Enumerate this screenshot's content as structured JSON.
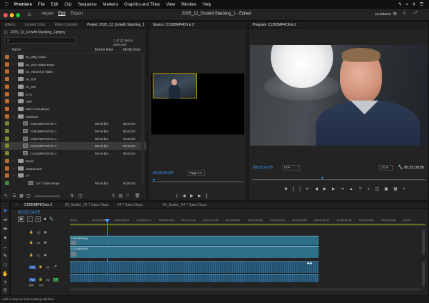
{
  "menubar": {
    "app_name": "Premiere",
    "items": [
      "File",
      "Edit",
      "Clip",
      "Sequence",
      "Markers",
      "Graphics and Titles",
      "View",
      "Window",
      "Help"
    ],
    "clock_area_icons": [
      "apple-logo-icon",
      "pencil-icon",
      "wifi-icon",
      "search-icon",
      "control-center-icon"
    ]
  },
  "appbar": {
    "tabs": [
      "Import",
      "Edit",
      "Export"
    ],
    "title": "2025_12_Growth Stacking_1 - Edited",
    "learning": "LEARNING"
  },
  "project_panel": {
    "tabs": [
      "Effects",
      "Lumetri Color",
      "Effect Controls",
      "Project: 2025_12_Growth Stacking_1"
    ],
    "project_file": "2025_12_Growth Stacking_1.prproj",
    "search_placeholder": "",
    "selection_info": "1 of 21 items selected",
    "columns": {
      "name": "Name",
      "frame_rate": "Frame Rate",
      "media_start": "Media Start"
    },
    "items": [
      {
        "name": "01_Why Video",
        "type": "bin",
        "color": "#c46a2a"
      },
      {
        "name": "02_24/7 Sales Reps",
        "type": "bin",
        "color": "#c46a2a"
      },
      {
        "name": "02_About Us Video",
        "type": "bin",
        "color": "#c46a2a"
      },
      {
        "name": "04_ICP",
        "type": "bin",
        "color": "#c46a2a"
      },
      {
        "name": "04_ICP",
        "type": "bin",
        "color": "#c46a2a"
      },
      {
        "name": "KYC",
        "type": "bin",
        "color": "#c46a2a"
      },
      {
        "name": "ABV",
        "type": "bin",
        "color": "#c46a2a"
      },
      {
        "name": "Main Animations",
        "type": "bin",
        "color": "#c46a2a"
      },
      {
        "name": "Multicam",
        "type": "bin-open",
        "color": "#c46a2a"
      },
      {
        "name": "C0614MP4Chris 1",
        "type": "clip",
        "color": "#7c8a2e",
        "fps": "59.94 fps",
        "start": "00;00;00"
      },
      {
        "name": "C0615MP4Chris 2",
        "type": "clip",
        "color": "#7c8a2e",
        "fps": "59.94 fps",
        "start": "00;00;00"
      },
      {
        "name": "C0637MP4Chris 2",
        "type": "clip",
        "color": "#7c8a2e",
        "fps": "59.94 fps",
        "start": "00;00;00"
      },
      {
        "name": "C1202MP4Chris 2",
        "type": "clip",
        "color": "#7c8a2e",
        "fps": "59.94 fps",
        "start": "00;00;00",
        "selected": true
      },
      {
        "name": "C1203MP4Chris 2",
        "type": "clip",
        "color": "#7c8a2e",
        "fps": "59.94 fps",
        "start": "00;00;00"
      },
      {
        "name": "Music",
        "type": "bin",
        "color": "#c46a2a"
      },
      {
        "name": "Sequences",
        "type": "bin-open",
        "color": "#c46a2a"
      },
      {
        "name": "YT",
        "type": "bin-open",
        "color": "#c46a2a"
      },
      {
        "name": "24 7 Sales Reps",
        "type": "seq",
        "color": "#3a8a3a",
        "fps": "59.94 fps",
        "start": "00;00;00"
      }
    ]
  },
  "source_monitor": {
    "tab": "Source: C1202MP4Chris 2",
    "timecode": "00;00;00;00",
    "page": "Page 1"
  },
  "program_monitor": {
    "tab": "Program: C1202MP4Chris 2",
    "timecode": "00;03;24;05",
    "fit": "Fit",
    "quality": "1/2",
    "duration": "00;22;38;56"
  },
  "timeline": {
    "tabs": [
      "C1202MP4Chris 2",
      "05_Sodial _24 7 Sales Reps",
      "24 7 Sales Reps",
      "04_Sodial _24 7 Sales Reps"
    ],
    "timecode": "00;03;24;05",
    "ruler_ticks": [
      "00;00",
      "00;02;08;09",
      "00;04;16;16",
      "00;06;24;24",
      "00;08;33;33",
      "00;10;41;41",
      "00;12;49;49",
      "00;14;58;02",
      "00;17;06;06",
      "00;19;15;15",
      "00;21;23;23",
      "00;23;31;31",
      "00;25;39;38",
      "00;27;48;48",
      "00;29;56;56",
      "00;32"
    ],
    "tracks": {
      "v_labels": [
        "V3",
        "V2",
        "V1"
      ],
      "a_labels": [
        "A1",
        "A2",
        "A3"
      ],
      "mix": "Mix",
      "mix_value": "0.0"
    },
    "clips": {
      "v_clip_1": "C0630MP4[V]",
      "v_clip_2": "C1202MP4[V]"
    }
  },
  "status_bar": {
    "text": "Add or remove from existing selection"
  },
  "colors": {
    "bin_orange": "#c46a2a",
    "clip_olive": "#7c8a2e",
    "timecode_blue": "#3d9cff",
    "video_clip": "#2d6f86",
    "audio_clip": "#244f6c",
    "playhead": "#3d9cff"
  }
}
